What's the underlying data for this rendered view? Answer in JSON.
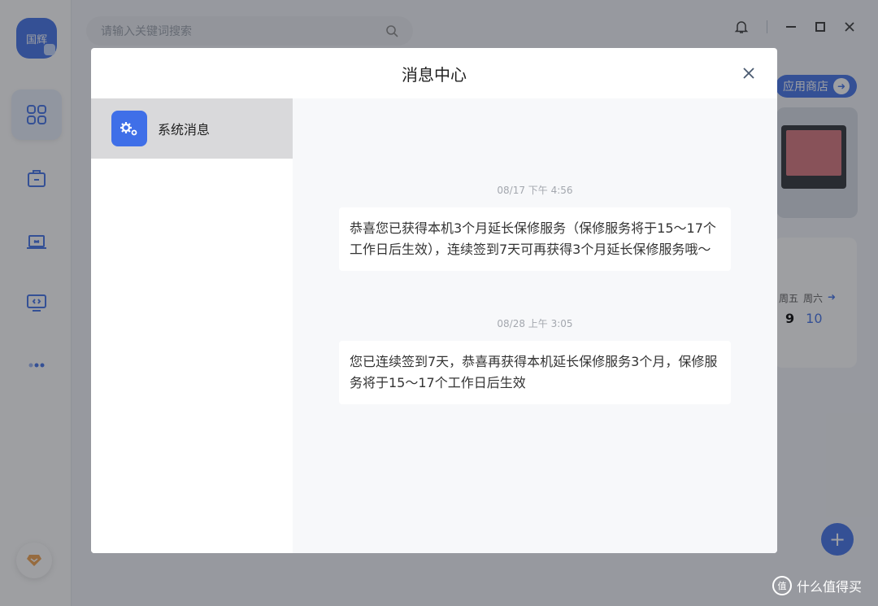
{
  "sidebar": {
    "avatar_text": "国辉",
    "nav_items": [
      "apps",
      "toolbox",
      "device",
      "remote-desktop",
      "more"
    ]
  },
  "search": {
    "placeholder": "请输入关键词搜索"
  },
  "store_button": {
    "label": "应用商店"
  },
  "calendar": {
    "weekdays": [
      "周五",
      "周六"
    ],
    "days": [
      "9",
      "10"
    ]
  },
  "modal": {
    "title": "消息中心",
    "categories": [
      {
        "label": "系统消息",
        "icon": "gears-icon"
      }
    ],
    "messages": [
      {
        "time": "08/17 下午 4:56",
        "text": "恭喜您已获得本机3个月延长保修服务（保修服务将于15～17个工作日后生效），连续签到7天可再获得3个月延长保修服务哦～"
      },
      {
        "time": "08/28 上午 3:05",
        "text": "您已连续签到7天，恭喜再获得本机延长保修服务3个月，保修服务将于15～17个工作日后生效"
      }
    ]
  },
  "watermark": {
    "text": "什么值得买",
    "logo": "值"
  },
  "colors": {
    "accent": "#3f6fe8",
    "selected_bg": "#d9d9db"
  }
}
